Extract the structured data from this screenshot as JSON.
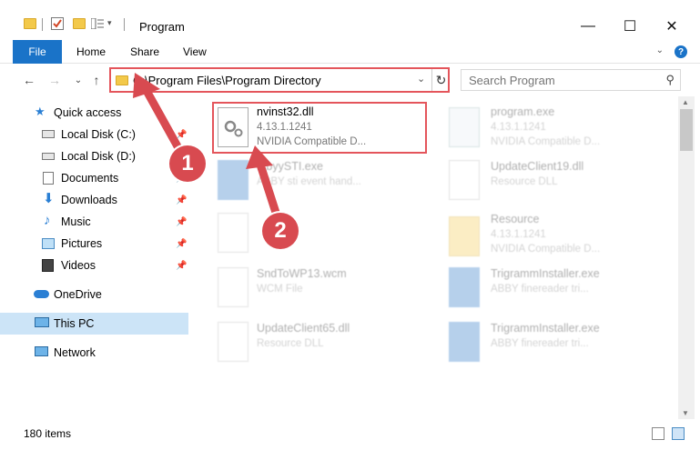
{
  "window": {
    "title": "Program",
    "controls": {
      "minimize": "—",
      "maximize": "☐",
      "close": "✕"
    }
  },
  "ribbon": {
    "tabs": [
      "File",
      "Home",
      "Share",
      "View"
    ]
  },
  "address": {
    "path": "C:\\Program Files\\Program Directory"
  },
  "search": {
    "placeholder": "Search Program"
  },
  "sidebar": {
    "quick_access": "Quick access",
    "items": [
      {
        "label": "Local Disk (C:)",
        "icon": "drive-icon",
        "pinned": true
      },
      {
        "label": "Local Disk (D:)",
        "icon": "drive-icon",
        "pinned": false
      },
      {
        "label": "Documents",
        "icon": "documents-icon",
        "pinned": true
      },
      {
        "label": "Downloads",
        "icon": "downloads-icon",
        "pinned": true
      },
      {
        "label": "Music",
        "icon": "music-icon",
        "pinned": true
      },
      {
        "label": "Pictures",
        "icon": "pictures-icon",
        "pinned": true
      },
      {
        "label": "Videos",
        "icon": "videos-icon",
        "pinned": true
      }
    ],
    "onedrive": "OneDrive",
    "this_pc": "This PC",
    "network": "Network"
  },
  "files": {
    "highlighted": {
      "name": "nvinst32.dll",
      "version": "4.13.1.1241",
      "desc": "NVIDIA Compatible D..."
    },
    "background": [
      {
        "name": "program.exe",
        "line2": "4.13.1.1241",
        "line3": "NVIDIA Compatible D..."
      },
      {
        "name": "...byySTI.exe",
        "line2": "ABBY sti event hand...",
        "line3": ""
      },
      {
        "name": "UpdateClient19.dll",
        "line2": "Resource DLL",
        "line3": ""
      },
      {
        "name": "Resource",
        "line2": "4.13.1.1241",
        "line3": "NVIDIA Compatible D..."
      },
      {
        "name": "SndToWP13.wcm",
        "line2": "WCM File",
        "line3": ""
      },
      {
        "name": "TrigrammInstaller.exe",
        "line2": "ABBY finereader tri...",
        "line3": ""
      },
      {
        "name": "UpdateClient65.dll",
        "line2": "Resource DLL",
        "line3": ""
      },
      {
        "name": "TrigrammInstaller.exe",
        "line2": "ABBY finereader tri...",
        "line3": ""
      }
    ]
  },
  "status": {
    "item_count": "180 items"
  },
  "annotations": {
    "step1": "1",
    "step2": "2",
    "color": "#d84a50"
  }
}
